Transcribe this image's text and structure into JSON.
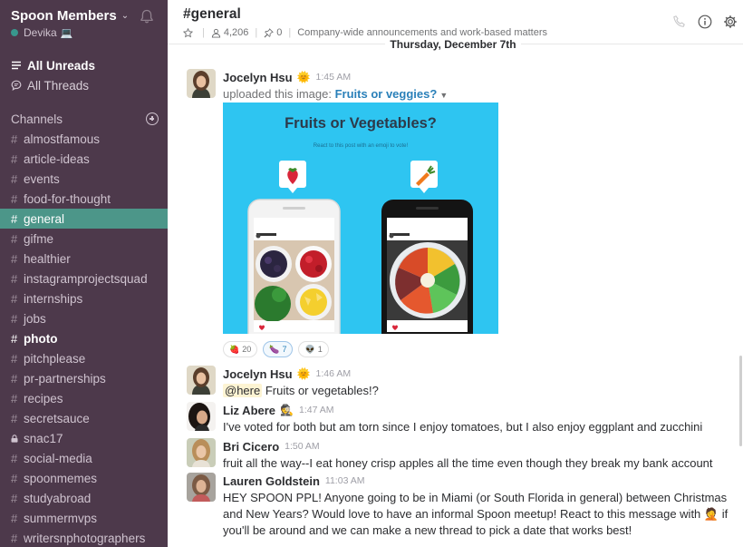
{
  "sidebar": {
    "team_name": "Spoon Members",
    "user_name": "Devika",
    "user_status_emoji": "💻",
    "all_unreads": "All Unreads",
    "all_threads": "All Threads",
    "channels_label": "Channels",
    "channels": [
      {
        "name": "almostfamous"
      },
      {
        "name": "article-ideas"
      },
      {
        "name": "events"
      },
      {
        "name": "food-for-thought"
      },
      {
        "name": "general",
        "active": true
      },
      {
        "name": "gifme"
      },
      {
        "name": "healthier"
      },
      {
        "name": "instagramprojectsquad"
      },
      {
        "name": "internships"
      },
      {
        "name": "jobs"
      },
      {
        "name": "photo",
        "bold": true
      },
      {
        "name": "pitchplease"
      },
      {
        "name": "pr-partnerships"
      },
      {
        "name": "recipes"
      },
      {
        "name": "secretsauce"
      },
      {
        "name": "snac17",
        "private": true
      },
      {
        "name": "social-media"
      },
      {
        "name": "spoonmemes"
      },
      {
        "name": "studyabroad"
      },
      {
        "name": "summermvps"
      },
      {
        "name": "writersnphotographers"
      }
    ]
  },
  "header": {
    "channel_title": "#general",
    "member_count": "4,206",
    "pinned_count": "0",
    "topic": "Company-wide announcements and work-based matters"
  },
  "date_divider": "Thursday, December 7th",
  "messages": [
    {
      "sender": "Jocelyn Hsu",
      "badge": "🌞",
      "time": "1:45 AM",
      "upload_prefix": "uploaded this image:",
      "upload_title": "Fruits or veggies?",
      "image": {
        "title": "Fruits or Vegetables?",
        "subtitle": "React to this post with an emoji to vote!",
        "left_tag_icon": "strawberry-icon",
        "right_tag_icon": "carrot-icon"
      },
      "reactions": [
        {
          "emoji": "🍓",
          "count": "20"
        },
        {
          "emoji": "🍆",
          "count": "7",
          "mine": true
        },
        {
          "emoji": "👽",
          "count": "1"
        }
      ]
    },
    {
      "sender": "Jocelyn Hsu",
      "badge": "🌞",
      "time": "1:46 AM",
      "mention": "@here",
      "text": " Fruits or vegetables!?"
    },
    {
      "sender": "Liz Abere",
      "badge": "🕵",
      "time": "1:47 AM",
      "text": "I've voted for both but am torn since I enjoy tomatoes, but I also enjoy eggplant and zucchini"
    },
    {
      "sender": "Bri Cicero",
      "time": "1:50 AM",
      "text": "fruit all the way--I eat honey crisp apples all the time even though they break my bank account"
    },
    {
      "sender": "Lauren Goldstein",
      "time": "11:03 AM",
      "text_line1": "HEY SPOON PPL! Anyone going to be in Miami (or South Florida in general) between Christmas",
      "text_line2": "and New Years? Would love to have an informal Spoon meetup! React to this message with",
      "text_emoji": "🤦",
      "text_line2_end": " if",
      "text_line3": "you'll be around and we can make a new thread to pick a date that works best!"
    }
  ],
  "colors": {
    "sidebar_bg": "#4d394b",
    "active_channel": "#4c9689",
    "link": "#2a80b9",
    "image_bg": "#2ec5f1"
  }
}
